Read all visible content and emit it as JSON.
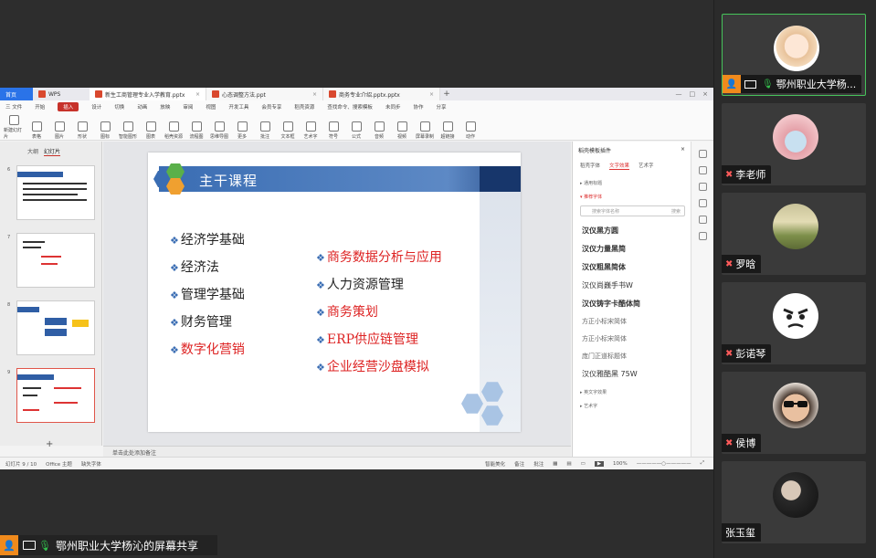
{
  "app": {
    "tabs": [
      {
        "label": "首页"
      },
      {
        "label": "WPS"
      },
      {
        "label": "新生工商管理专业入学教育.pptx"
      },
      {
        "label": "心态调整方法.ppt"
      },
      {
        "label": "商务专业介绍.pptx.pptx"
      }
    ],
    "menu": [
      "三 文件",
      "开始",
      "插入",
      "设计",
      "切换",
      "动画",
      "放映",
      "审阅",
      "视图",
      "开发工具",
      "会员专享",
      "稻壳资源",
      "查找命令、搜索模板",
      "未同步",
      "协作",
      "分享"
    ],
    "menu_active_index": 2,
    "ribbon": [
      "新建幻灯片",
      "表格",
      "图片",
      "形状",
      "图标",
      "智能图形",
      "图表",
      "稻壳资源",
      "流程图",
      "思维导图",
      "更多",
      "批注",
      "文本框",
      "艺术字",
      "符号",
      "公式",
      "音频",
      "视频",
      "屏幕录制",
      "超链接",
      "动作"
    ],
    "left_tabs": [
      "大纲",
      "幻灯片"
    ],
    "left_active_tab": 1,
    "thumb_numbers": [
      "6",
      "7",
      "8",
      "9"
    ],
    "notes_placeholder": "单击此处添加备注",
    "status": {
      "slide_info": "幻灯片 9 / 10",
      "theme": "Office 主题",
      "font_missing": "缺失字体",
      "beautify": "智能美化",
      "notes": "备注",
      "comments": "批注",
      "zoom": "100%"
    }
  },
  "slide": {
    "title": "主干课程",
    "left_courses": [
      {
        "text": "经济学基础",
        "color": "black"
      },
      {
        "text": "经济法",
        "color": "black"
      },
      {
        "text": "管理学基础",
        "color": "black"
      },
      {
        "text": "财务管理",
        "color": "black"
      },
      {
        "text": "数字化营销",
        "color": "red"
      }
    ],
    "right_courses": [
      {
        "text": "商务数据分析与应用",
        "color": "red"
      },
      {
        "text": "人力资源管理",
        "color": "black"
      },
      {
        "text": "商务策划",
        "color": "red"
      },
      {
        "text": "ERP供应链管理",
        "color": "red"
      },
      {
        "text": "企业经营沙盘模拟",
        "color": "red"
      }
    ],
    "bullet": "❖"
  },
  "right_panel": {
    "title": "稻壳模板插件",
    "tabs": [
      "稻壳字体",
      "文字效果",
      "艺术字"
    ],
    "active_tab": 1,
    "section1": "▸ 通用标题",
    "section2": "▾ 推荐字体",
    "search_placeholder": "搜索字体名称",
    "search_btn": "搜索",
    "fonts": [
      "汉仪黑方圆",
      "汉仪力量黑简",
      "汉仪粗黑简体",
      "汉仪尚巍手书W",
      "汉仪铸字卡酷体简",
      "方正小标宋简体",
      "方正小标宋简体",
      "庞门正道标题体",
      "汉仪雅酷黑 75W"
    ],
    "section3": "▸ 英文字效果",
    "section4": "▸ 艺术字"
  },
  "share": {
    "label": "鄂州职业大学杨沁的屏幕共享"
  },
  "participants": [
    {
      "name": "鄂州职业大学杨...",
      "mic": "on",
      "active": true,
      "avatar": "cartoon-girl"
    },
    {
      "name": "李老师",
      "mic": "muted",
      "active": false,
      "avatar": "family-photo"
    },
    {
      "name": "罗晗",
      "mic": "muted",
      "active": false,
      "avatar": "landscape-photo"
    },
    {
      "name": "彭诺琴",
      "mic": "muted",
      "active": false,
      "avatar": "angry-face-emoji"
    },
    {
      "name": "侯博",
      "mic": "muted",
      "active": false,
      "avatar": "child-sunglasses"
    },
    {
      "name": "张玉玺",
      "mic": "none",
      "active": false,
      "avatar": "person-photo"
    }
  ],
  "colors": {
    "title_bar": "#3a6db3",
    "title_dark": "#17366b",
    "course_red": "#d22222",
    "course_black": "#222222",
    "active_speaker": "#46c35a",
    "mic_muted": "#ff5b5b",
    "mic_on": "#35c24e",
    "host_badge": "#f08a1c"
  }
}
